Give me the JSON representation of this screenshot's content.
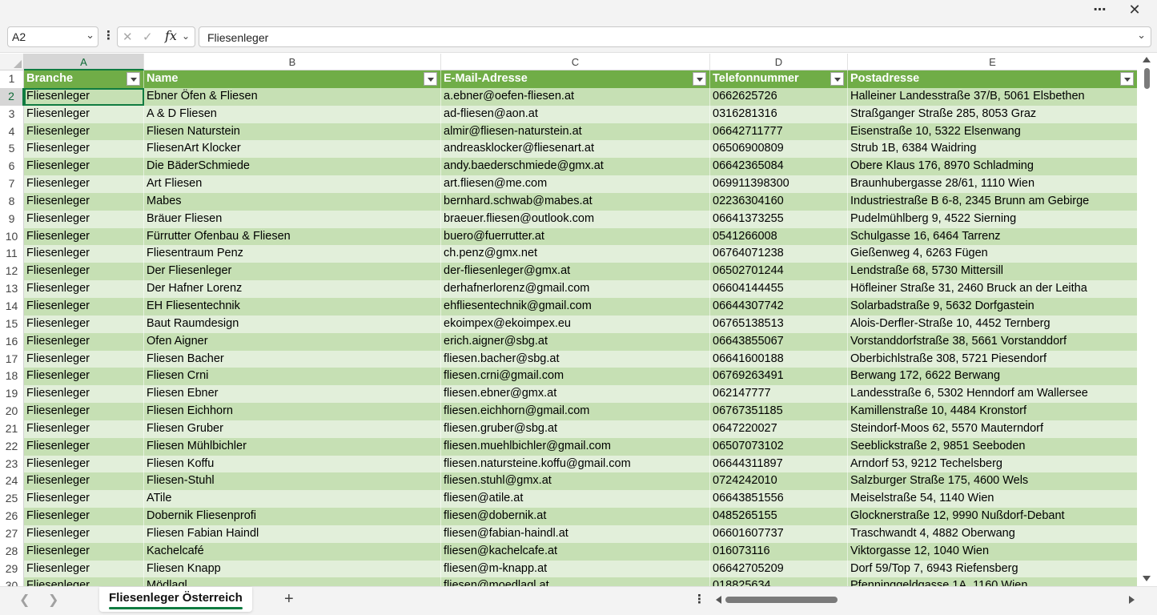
{
  "titlebar": {
    "more_icon": "⋯",
    "close_icon": "✕"
  },
  "formula_bar": {
    "name_box": "A2",
    "formula": "Fliesenleger"
  },
  "colors": {
    "header_green": "#70ad47",
    "band_dark": "#c6e0b4",
    "band_light": "#e2efda",
    "accent": "#107c41"
  },
  "columns": [
    {
      "letter": "A"
    },
    {
      "letter": "B"
    },
    {
      "letter": "C"
    },
    {
      "letter": "D"
    },
    {
      "letter": "E"
    }
  ],
  "table_header": [
    "Branche",
    "Name",
    "E-Mail-Adresse",
    "Telefonnummer",
    "Postadresse"
  ],
  "rows": [
    {
      "num": "2",
      "cells": [
        "Fliesenleger",
        "Ebner Öfen & Fliesen",
        "a.ebner@oefen-fliesen.at",
        "0662625726",
        "Halleiner Landesstraße 37/B, 5061 Elsbethen"
      ]
    },
    {
      "num": "3",
      "cells": [
        "Fliesenleger",
        "A & D Fliesen",
        "ad-fliesen@aon.at",
        "0316281316",
        "Straßganger Straße 285, 8053 Graz"
      ]
    },
    {
      "num": "4",
      "cells": [
        "Fliesenleger",
        "Fliesen Naturstein",
        "almir@fliesen-naturstein.at",
        "06642711777",
        "Eisenstraße 10, 5322 Elsenwang"
      ]
    },
    {
      "num": "5",
      "cells": [
        "Fliesenleger",
        "FliesenArt Klocker",
        "andreasklocker@fliesenart.at",
        "06506900809",
        "Strub 1B, 6384 Waidring"
      ]
    },
    {
      "num": "6",
      "cells": [
        "Fliesenleger",
        "Die BäderSchmiede",
        "andy.baederschmiede@gmx.at",
        "06642365084",
        "Obere Klaus 176, 8970 Schladming"
      ]
    },
    {
      "num": "7",
      "cells": [
        "Fliesenleger",
        "Art Fliesen",
        "art.fliesen@me.com",
        "069911398300",
        "Braunhubergasse 28/61, 1110 Wien"
      ]
    },
    {
      "num": "8",
      "cells": [
        "Fliesenleger",
        "Mabes",
        "bernhard.schwab@mabes.at",
        "02236304160",
        "Industriestraße B 6-8, 2345 Brunn am Gebirge"
      ]
    },
    {
      "num": "9",
      "cells": [
        "Fliesenleger",
        "Bräuer Fliesen",
        "braeuer.fliesen@outlook.com",
        "06641373255",
        "Pudelmühlberg 9, 4522 Sierning"
      ]
    },
    {
      "num": "10",
      "cells": [
        "Fliesenleger",
        "Fürrutter Ofenbau & Fliesen",
        "buero@fuerrutter.at",
        "0541266008",
        "Schulgasse 16, 6464 Tarrenz"
      ]
    },
    {
      "num": "11",
      "cells": [
        "Fliesenleger",
        "Fliesentraum Penz",
        "ch.penz@gmx.net",
        "06764071238",
        "Gießenweg 4, 6263 Fügen"
      ]
    },
    {
      "num": "12",
      "cells": [
        "Fliesenleger",
        "Der Fliesenleger",
        "der-fliesenleger@gmx.at",
        "06502701244",
        "Lendstraße 68, 5730 Mittersill"
      ]
    },
    {
      "num": "13",
      "cells": [
        "Fliesenleger",
        "Der Hafner Lorenz",
        "derhafnerlorenz@gmail.com",
        "06604144455",
        "Höfleiner Straße 31, 2460 Bruck an der Leitha"
      ]
    },
    {
      "num": "14",
      "cells": [
        "Fliesenleger",
        "EH Fliesentechnik",
        "ehfliesentechnik@gmail.com",
        "06644307742",
        "Solarbadstraße 9, 5632 Dorfgastein"
      ]
    },
    {
      "num": "15",
      "cells": [
        "Fliesenleger",
        "Baut Raumdesign",
        "ekoimpex@ekoimpex.eu",
        "06765138513",
        "Alois-Derfler-Straße 10, 4452 Ternberg"
      ]
    },
    {
      "num": "16",
      "cells": [
        "Fliesenleger",
        "Ofen Aigner",
        "erich.aigner@sbg.at",
        "06643855067",
        "Vorstanddorfstraße 38, 5661 Vorstanddorf"
      ]
    },
    {
      "num": "17",
      "cells": [
        "Fliesenleger",
        "Fliesen Bacher",
        "fliesen.bacher@sbg.at",
        "06641600188",
        "Oberbichlstraße 308, 5721 Piesendorf"
      ]
    },
    {
      "num": "18",
      "cells": [
        "Fliesenleger",
        "Fliesen Crni",
        "fliesen.crni@gmail.com",
        "06769263491",
        "Berwang 172, 6622 Berwang"
      ]
    },
    {
      "num": "19",
      "cells": [
        "Fliesenleger",
        "Fliesen Ebner",
        "fliesen.ebner@gmx.at",
        "062147777",
        "Landesstraße 6, 5302 Henndorf am Wallersee"
      ]
    },
    {
      "num": "20",
      "cells": [
        "Fliesenleger",
        "Fliesen Eichhorn",
        "fliesen.eichhorn@gmail.com",
        "06767351185",
        "Kamillenstraße 10, 4484 Kronstorf"
      ]
    },
    {
      "num": "21",
      "cells": [
        "Fliesenleger",
        "Fliesen Gruber",
        "fliesen.gruber@sbg.at",
        "0647220027",
        "Steindorf-Moos 62, 5570 Mauterndorf"
      ]
    },
    {
      "num": "22",
      "cells": [
        "Fliesenleger",
        "Fliesen Mühlbichler",
        "fliesen.muehlbichler@gmail.com",
        "06507073102",
        "Seeblickstraße 2, 9851 Seeboden"
      ]
    },
    {
      "num": "23",
      "cells": [
        "Fliesenleger",
        "Fliesen Koffu",
        "fliesen.natursteine.koffu@gmail.com",
        "06644311897",
        "Arndorf 53, 9212 Techelsberg"
      ]
    },
    {
      "num": "24",
      "cells": [
        "Fliesenleger",
        "Fliesen-Stuhl",
        "fliesen.stuhl@gmx.at",
        "0724242010",
        "Salzburger Straße 175, 4600 Wels"
      ]
    },
    {
      "num": "25",
      "cells": [
        "Fliesenleger",
        "ATile",
        "fliesen@atile.at",
        "06643851556",
        "Meiselstraße 54, 1140 Wien"
      ]
    },
    {
      "num": "26",
      "cells": [
        "Fliesenleger",
        "Dobernik Fliesenprofi",
        "fliesen@dobernik.at",
        "0485265155",
        "Glocknerstraße 12, 9990 Nußdorf-Debant"
      ]
    },
    {
      "num": "27",
      "cells": [
        "Fliesenleger",
        "Fliesen Fabian Haindl",
        "fliesen@fabian-haindl.at",
        "06601607737",
        "Traschwandt 4, 4882 Oberwang"
      ]
    },
    {
      "num": "28",
      "cells": [
        "Fliesenleger",
        "Kachelcafé",
        "fliesen@kachelcafe.at",
        "016073116",
        "Viktorgasse 12, 1040 Wien"
      ]
    },
    {
      "num": "29",
      "cells": [
        "Fliesenleger",
        "Fliesen Knapp",
        "fliesen@m-knapp.at",
        "06642705209",
        "Dorf 59/Top 7, 6943 Riefensberg"
      ]
    },
    {
      "num": "30",
      "cells": [
        "Fliesenleger",
        "Mödlagl",
        "fliesen@moedlagl.at",
        "018825634",
        "Pfenninggeldgasse 1A, 1160 Wien"
      ]
    }
  ],
  "sheet_bar": {
    "active_tab": "Fliesenleger Österreich",
    "add_icon": "+"
  }
}
